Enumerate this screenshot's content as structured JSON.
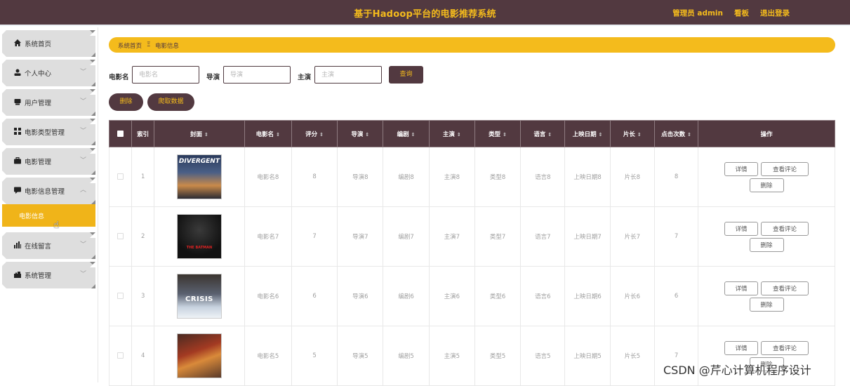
{
  "header": {
    "title": "基于Hadoop平台的电影推荐系统",
    "user_label": "管理员 admin",
    "dashboard_link": "看板",
    "logout_link": "退出登录",
    "bg_color": "#523940",
    "accent_color": "#f4bb1c"
  },
  "sidebar": {
    "items": [
      {
        "label": "系统首页",
        "icon": "home-icon",
        "has_chevron": false
      },
      {
        "label": "个人中心",
        "icon": "user-icon",
        "has_chevron": true
      },
      {
        "label": "用户管理",
        "icon": "users-icon",
        "has_chevron": true
      },
      {
        "label": "电影类型管理",
        "icon": "grid-icon",
        "has_chevron": true
      },
      {
        "label": "电影管理",
        "icon": "briefcase-icon",
        "has_chevron": true
      },
      {
        "label": "电影信息管理",
        "icon": "comment-icon",
        "has_chevron": true,
        "expanded": true
      },
      {
        "label": "在线留言",
        "icon": "bar-chart-icon",
        "has_chevron": true
      },
      {
        "label": "系统管理",
        "icon": "settings-icon",
        "has_chevron": true
      }
    ],
    "active_subitem": "电影信息",
    "chevron_down": "﹀",
    "chevron_up": "︿"
  },
  "breadcrumb": {
    "home": "系统首页",
    "separator": "Ξ",
    "current": "电影信息"
  },
  "search": {
    "fields": [
      {
        "label": "电影名",
        "placeholder": "电影名",
        "value": ""
      },
      {
        "label": "导演",
        "placeholder": "导演",
        "value": ""
      },
      {
        "label": "主演",
        "placeholder": "主演",
        "value": ""
      }
    ],
    "query_button": "查询"
  },
  "toolbar": {
    "delete_button": "删除",
    "crawl_button": "爬取数据"
  },
  "table": {
    "columns": [
      "索引",
      "封面",
      "电影名",
      "评分",
      "导演",
      "编剧",
      "主演",
      "类型",
      "语言",
      "上映日期",
      "片长",
      "点击次数",
      "操作"
    ],
    "sort_icon": "⇕",
    "rows": [
      {
        "index": "1",
        "cover": "DIVERGENT",
        "name": "电影名8",
        "rating": "8",
        "director": "导演8",
        "writer": "编剧8",
        "actor": "主演8",
        "type": "类型8",
        "language": "语言8",
        "release": "上映日期8",
        "duration": "片长8",
        "clicks": "8"
      },
      {
        "index": "2",
        "cover": "THE BATMAN",
        "name": "电影名7",
        "rating": "7",
        "director": "导演7",
        "writer": "编剧7",
        "actor": "主演7",
        "type": "类型7",
        "language": "语言7",
        "release": "上映日期7",
        "duration": "片长7",
        "clicks": "7"
      },
      {
        "index": "3",
        "cover": "CRISIS",
        "name": "电影名6",
        "rating": "6",
        "director": "导演6",
        "writer": "编剧6",
        "actor": "主演6",
        "type": "类型6",
        "language": "语言6",
        "release": "上映日期6",
        "duration": "片长6",
        "clicks": "6"
      },
      {
        "index": "4",
        "cover": "",
        "name": "电影名5",
        "rating": "5",
        "director": "导演5",
        "writer": "编剧5",
        "actor": "主演5",
        "type": "类型5",
        "language": "语言5",
        "release": "上映日期5",
        "duration": "片长5",
        "clicks": "7"
      }
    ],
    "actions": {
      "detail": "详情",
      "comments": "查看评论",
      "delete": "删除"
    }
  },
  "watermark": "CSDN @芹心计算机程序设计"
}
